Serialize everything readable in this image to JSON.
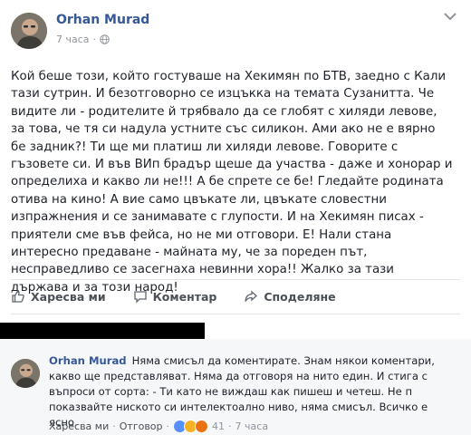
{
  "post": {
    "author": "Orhan Murad",
    "time": "7 часа",
    "text": "Кой беше този, който гостуваше на Хекимян по БТВ, заедно с Кали тази сутрин. И безотговорно се изцъкка на темата Сузанитта. Че видите ли - родителите й трябвало да се глобят с хиляди левове, за това, че тя си надула устните със силикон. Ами ако не е вярно бе задник?! Ти ще ми платиш ли хиляди левове. Говорите с гъзовете си. И във ВИп брадър щеше да участва - даже и хонорар и определиха и какво ли не!!! А бе спрете се бе! Гледайте родината отива на кино! А вие само цвъкате ли, цвъкате словестни изпражнения и се занимавате с глупости. И на Хекимян писах - приятели сме във фейса, но не ми отговори. Е! Нали стана интересно предаване - майната му, че за пореден път, несправедливо се засегнаха невинни хора!! Жалко за тази държава и за този народ!"
  },
  "actions": {
    "like": "Харесва ми",
    "comment": "Коментар",
    "share": "Споделяне"
  },
  "comment": {
    "author": "Orhan Murad",
    "text": "Няма смисъл да коментирате. Знам някои коментари, какво ще представляват. Няма да отговоря на нито един. И стига с въпроси от сорта: - Ти като не виждаш как пишеш и четеш. Не п показвайте ниското си интелектоално ниво, няма смисъл. Всичко е ясно.",
    "like_label": "Харесва ми",
    "reply_label": "Отговор",
    "sep": "·",
    "reactions_count": "41",
    "time": "7 часа"
  },
  "icons": {
    "menu": "chevron-down-icon",
    "privacy": "globe-icon",
    "like": "thumbs-up-icon",
    "comment": "speech-bubble-icon",
    "share": "share-arrow-icon"
  },
  "colors": {
    "link": "#365899",
    "muted": "#90949c",
    "action": "#4b4f56"
  }
}
